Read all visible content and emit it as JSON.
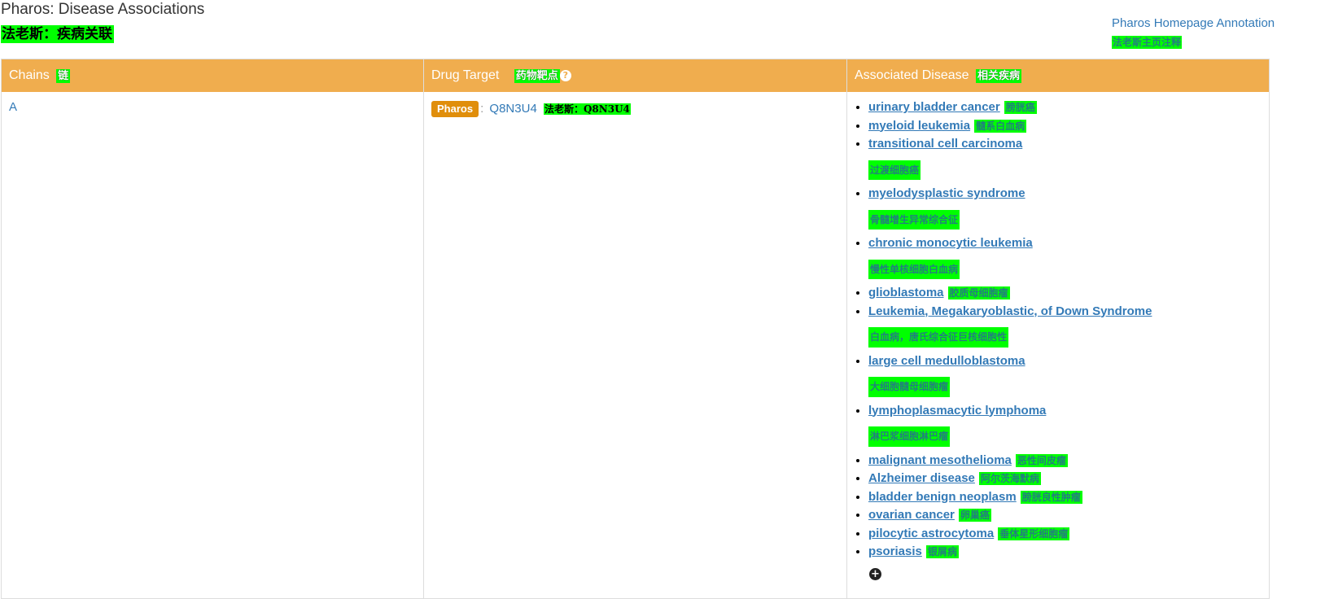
{
  "page": {
    "title": "Pharos: Disease Associations",
    "title_cn": "法老斯：疾病关联",
    "home_link": "Pharos Homepage Annotation",
    "home_link_cn": "法老斯主页注释"
  },
  "table": {
    "headers": {
      "chains": "Chains",
      "chains_cn": "链",
      "drug_target": "Drug Target",
      "drug_target_cn": "药物靶点",
      "help_icon": "?",
      "associated_disease": "Associated Disease",
      "associated_disease_cn": "相关疾病"
    },
    "row": {
      "chain": "A",
      "pharos_badge": "Pharos",
      "separator": ":",
      "target_id": "Q8N3U4",
      "target_cn": "法老斯：Q8N3U4",
      "diseases": [
        {
          "name": "urinary bladder cancer",
          "cn": "膀胱癌"
        },
        {
          "name": "myeloid leukemia",
          "cn": "髓系白血病"
        },
        {
          "name": "transitional cell carcinoma",
          "cn": "过渡细胞癌"
        },
        {
          "name": "myelodysplastic syndrome",
          "cn": "骨髓增生异常综合征"
        },
        {
          "name": "chronic monocytic leukemia",
          "cn": "慢性单核细胞白血病"
        },
        {
          "name": "glioblastoma",
          "cn": "胶质母细胞瘤"
        },
        {
          "name": "Leukemia, Megakaryoblastic, of Down Syndrome",
          "cn": "白血病，唐氏综合征巨核细胞性"
        },
        {
          "name": "large cell medulloblastoma",
          "cn": "大细胞髓母细胞瘤"
        },
        {
          "name": "lymphoplasmacytic lymphoma",
          "cn": "淋巴浆细胞淋巴瘤"
        },
        {
          "name": "malignant mesothelioma",
          "cn": "恶性间皮瘤"
        },
        {
          "name": "Alzheimer disease",
          "cn": "阿尔茨海默病"
        },
        {
          "name": "bladder benign neoplasm",
          "cn": "膀胱良性肿瘤"
        },
        {
          "name": "ovarian cancer",
          "cn": "卵巢癌"
        },
        {
          "name": "pilocytic astrocytoma",
          "cn": "垂体星形细胞瘤"
        },
        {
          "name": "psoriasis",
          "cn": "银屑病"
        }
      ],
      "more_icon": "+"
    }
  },
  "colors": {
    "header_bg": "#f0ad4e",
    "highlight": "#00ff00",
    "link": "#337ab7",
    "badge": "#e08e0b"
  }
}
